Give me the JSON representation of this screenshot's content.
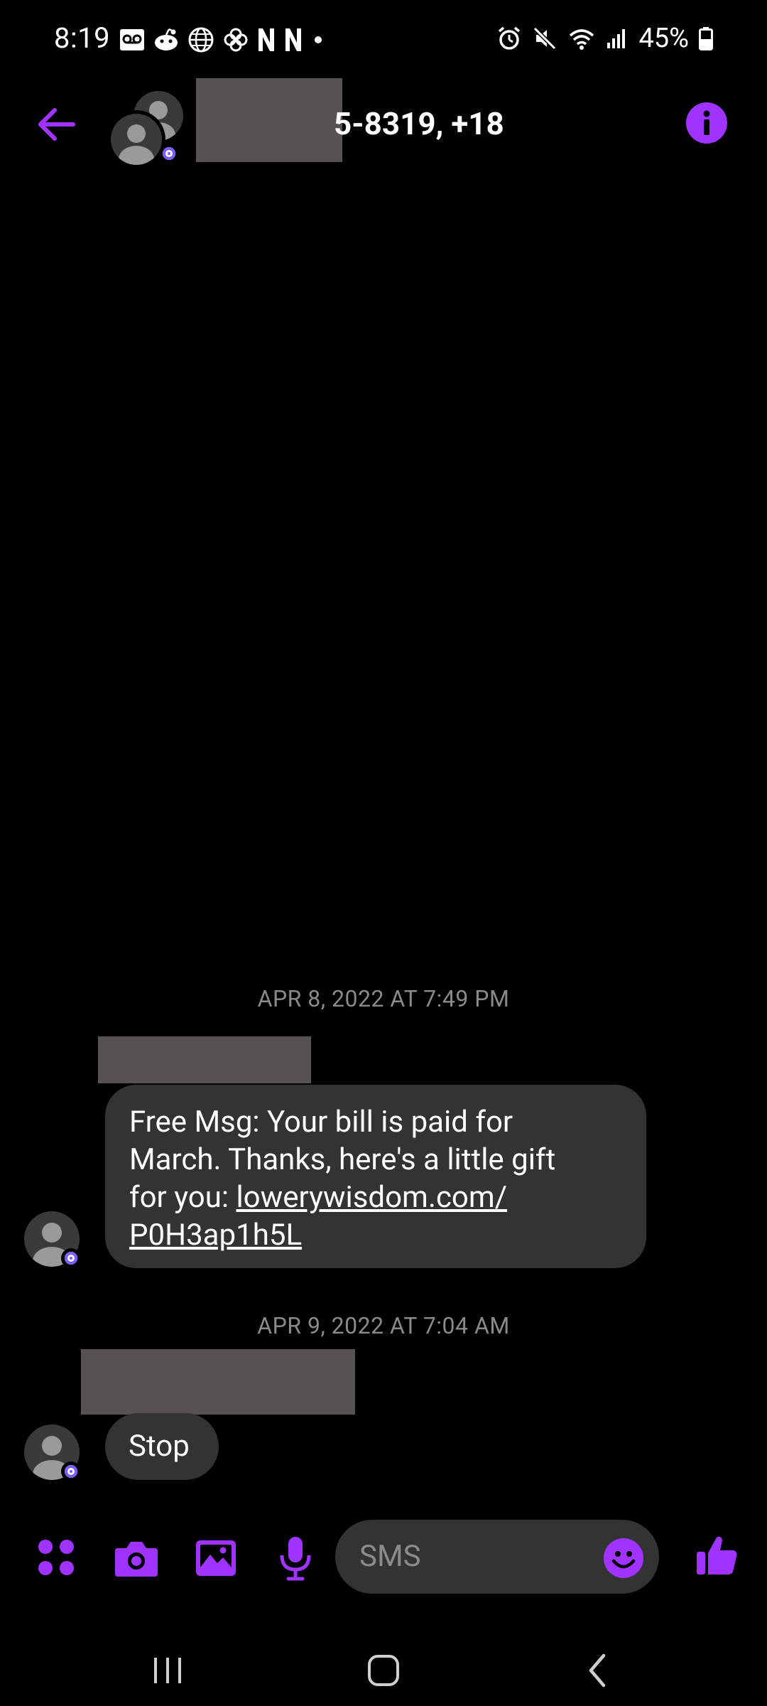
{
  "status_bar": {
    "time": "8:19",
    "battery": "45%",
    "left_icons": [
      "voicemail-icon",
      "reddit-icon",
      "globe-icon",
      "pinwheel-icon",
      "netflix-icon",
      "netflix-icon",
      "dot-icon"
    ],
    "right_icons": [
      "alarm-icon",
      "mute-icon",
      "wifi-icon",
      "signal-icon",
      "battery-icon"
    ]
  },
  "header": {
    "title": "5-8319, +18",
    "back_icon": "arrow-left-icon",
    "info_icon": "info-icon"
  },
  "messages": [
    {
      "timestamp": "APR 8, 2022 AT 7:49 PM",
      "text_lines": [
        "Free Msg: Your bill is paid for",
        "March. Thanks, here's a little gift",
        "for you: "
      ],
      "link_part1": "lowerywisdom.com/",
      "link_part2": "P0H3ap1h5L"
    },
    {
      "timestamp": "APR 9, 2022 AT 7:04 AM",
      "text": "Stop"
    }
  ],
  "composer": {
    "placeholder": "SMS",
    "icons": [
      "apps-icon",
      "camera-icon",
      "gallery-icon",
      "microphone-icon",
      "emoji-icon",
      "thumbs-up-icon"
    ]
  },
  "nav_bar": {
    "icons": [
      "recent-apps-icon",
      "home-icon",
      "back-icon"
    ]
  },
  "colors": {
    "accent": "#a033ff",
    "bubble": "#333333",
    "background": "#000000",
    "timestamp": "#8a8a8a",
    "redaction": "#565252"
  }
}
